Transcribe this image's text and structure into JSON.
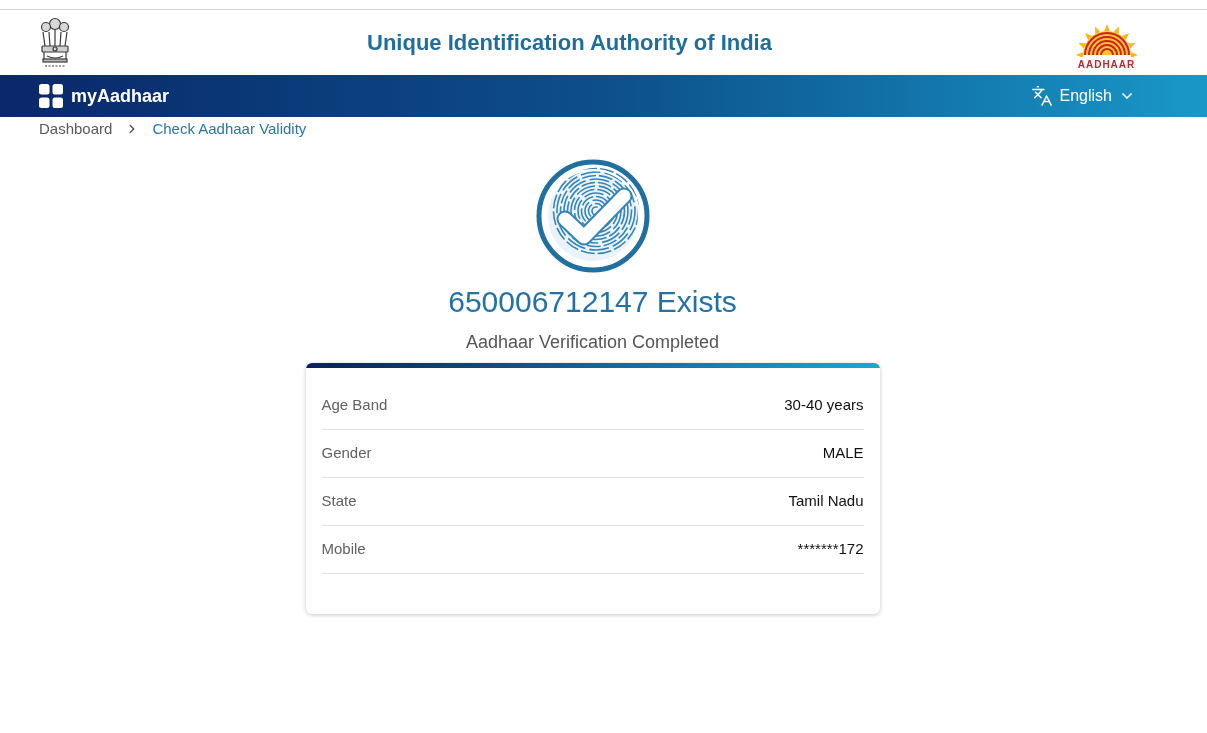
{
  "header": {
    "title": "Unique Identification Authority of India",
    "logo_text": "AADHAAR"
  },
  "navbar": {
    "app_name": "myAadhaar",
    "language": "English"
  },
  "breadcrumb": [
    {
      "label": "Dashboard",
      "current": false
    },
    {
      "label": "Check Aadhaar Validity",
      "current": true
    }
  ],
  "result": {
    "heading": "650006712147 Exists",
    "subtitle": "Aadhaar Verification Completed"
  },
  "details": [
    {
      "label": "Age Band",
      "value": "30-40 years"
    },
    {
      "label": "Gender",
      "value": "MALE"
    },
    {
      "label": "State",
      "value": "Tamil Nadu"
    },
    {
      "label": "Mobile",
      "value": "*******172"
    }
  ]
}
